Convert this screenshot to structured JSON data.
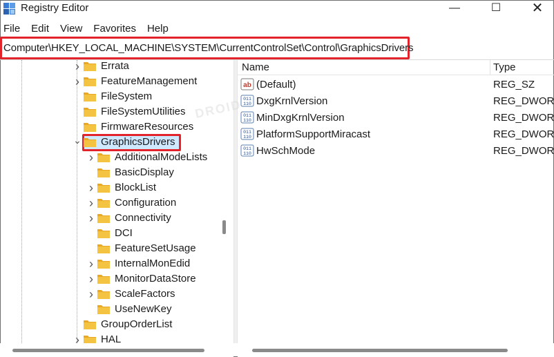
{
  "window": {
    "title": "Registry Editor",
    "controls": {
      "minimize": "—",
      "maximize": "☐",
      "close": "✕"
    }
  },
  "menu": [
    "File",
    "Edit",
    "View",
    "Favorites",
    "Help"
  ],
  "address": "Computer\\HKEY_LOCAL_MACHINE\\SYSTEM\\CurrentControlSet\\Control\\GraphicsDrivers",
  "tree": {
    "nodes": [
      {
        "label": "Errata",
        "expander": "›"
      },
      {
        "label": "FeatureManagement",
        "expander": "›"
      },
      {
        "label": "FileSystem",
        "expander": ""
      },
      {
        "label": "FileSystemUtilities",
        "expander": ""
      },
      {
        "label": "FirmwareResources",
        "expander": ""
      },
      {
        "label": "GraphicsDrivers",
        "expander": "⌄",
        "selected": true
      },
      {
        "label": "AdditionalModeLists",
        "expander": "›"
      },
      {
        "label": "BasicDisplay",
        "expander": ""
      },
      {
        "label": "BlockList",
        "expander": "›"
      },
      {
        "label": "Configuration",
        "expander": "›"
      },
      {
        "label": "Connectivity",
        "expander": "›"
      },
      {
        "label": "DCI",
        "expander": ""
      },
      {
        "label": "FeatureSetUsage",
        "expander": ""
      },
      {
        "label": "InternalMonEdid",
        "expander": "›"
      },
      {
        "label": "MonitorDataStore",
        "expander": "›"
      },
      {
        "label": "ScaleFactors",
        "expander": "›"
      },
      {
        "label": "UseNewKey",
        "expander": ""
      },
      {
        "label": "GroupOrderList",
        "expander": ""
      },
      {
        "label": "HAL",
        "expander": "›"
      }
    ]
  },
  "list": {
    "headers": {
      "name": "Name",
      "type": "Type"
    },
    "rows": [
      {
        "name": "(Default)",
        "type": "REG_SZ",
        "icon": "string-value-icon"
      },
      {
        "name": "DxgKrnlVersion",
        "type": "REG_DWORD",
        "icon": "binary-value-icon"
      },
      {
        "name": "MinDxgKrnlVersion",
        "type": "REG_DWORD",
        "icon": "binary-value-icon"
      },
      {
        "name": "PlatformSupportMiracast",
        "type": "REG_DWORD",
        "icon": "binary-value-icon"
      },
      {
        "name": "HwSchMode",
        "type": "REG_DWORD",
        "icon": "binary-value-icon"
      }
    ]
  },
  "watermark": "DROID",
  "colors": {
    "highlight_border": "#e2232a",
    "selection": "#cde8ff",
    "folder": "#f5c342"
  }
}
